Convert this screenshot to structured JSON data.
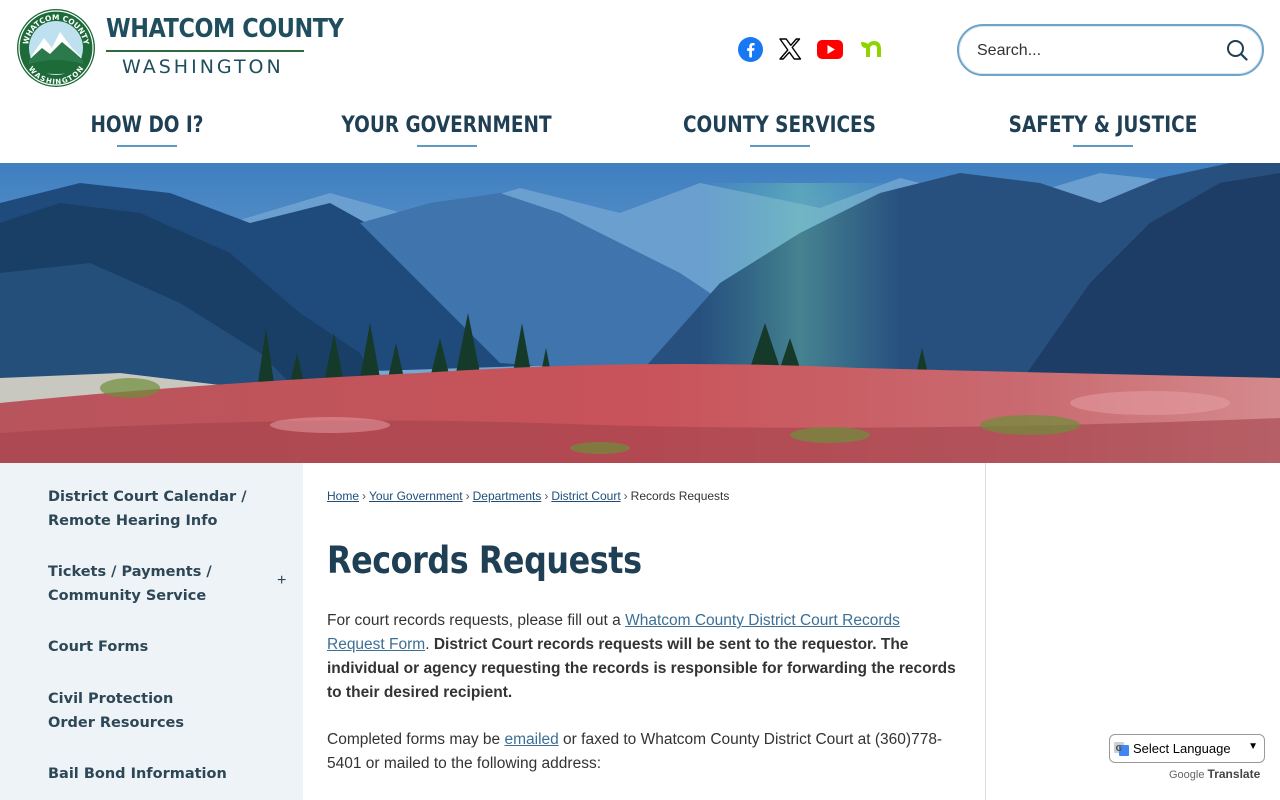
{
  "header": {
    "logo_title": "WHATCOM COUNTY",
    "logo_subtitle": "WASHINGTON",
    "seal_text_top": "WHATCOM COUNTY",
    "seal_text_bottom": "WASHINGTON"
  },
  "social": [
    {
      "name": "facebook",
      "icon": "facebook-icon",
      "color": "#1877f2"
    },
    {
      "name": "x",
      "icon": "x-icon",
      "color": "#000000"
    },
    {
      "name": "youtube",
      "icon": "youtube-icon",
      "color": "#ff0000"
    },
    {
      "name": "nextdoor",
      "icon": "nextdoor-icon",
      "color": "#8ed500"
    }
  ],
  "search": {
    "placeholder": "Search...",
    "icon": "search-icon"
  },
  "nav": {
    "items": [
      {
        "label": "HOW DO I?"
      },
      {
        "label": "YOUR GOVERNMENT"
      },
      {
        "label": "COUNTY SERVICES"
      },
      {
        "label": "SAFETY & JUSTICE"
      }
    ]
  },
  "sidebar": {
    "items": [
      {
        "label": "District Court Calendar / Remote Hearing Info"
      },
      {
        "label": "Tickets / Payments / Community Service",
        "expand": "+"
      },
      {
        "label": "Court Forms"
      },
      {
        "label": "Civil Protection Order Resources"
      },
      {
        "label": "Bail Bond Information"
      }
    ]
  },
  "breadcrumb": {
    "items": [
      "Home",
      "Your Government",
      "Departments",
      "District Court"
    ],
    "current": "Records Requests",
    "separator": "›"
  },
  "main": {
    "title": "Records Requests",
    "p1_text1": "For court records requests, please fill out a ",
    "p1_link": "Whatcom County District Court Records Request Form",
    "p1_text2": ". ",
    "p1_bold": "District Court records requests will be sent to the requestor. The individual or agency requesting the records is responsible for forwarding the records to their desired recipient.",
    "p2_text1": "Completed forms may be ",
    "p2_link": "emailed",
    "p2_text2": " or faxed to Whatcom County District Court at (360)778-5401 or mailed to the following address:"
  },
  "translate": {
    "select_label": "Select Language",
    "powered_prefix": "Google",
    "powered_suffix": "Translate"
  },
  "colors": {
    "brand_navy": "#1f3f55",
    "link_blue": "#3b6f95",
    "sidebar_bg": "#eef3f7",
    "accent_underline": "#5f9ac2"
  }
}
